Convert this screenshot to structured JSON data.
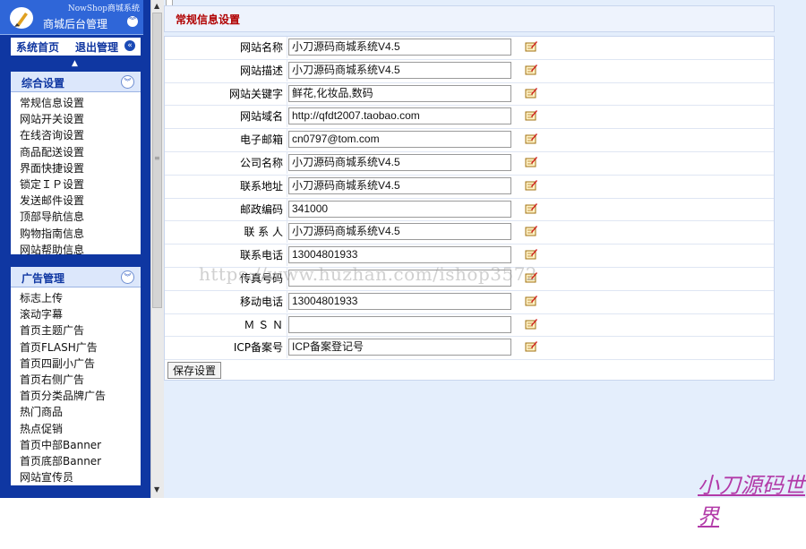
{
  "brand": {
    "system_name": "NowShop商城系统",
    "title": "商城后台管理"
  },
  "topnav": {
    "home": "系统首页",
    "logout": "退出管理"
  },
  "panels": [
    {
      "title": "综合设置",
      "items": [
        "常规信息设置",
        "网站开关设置",
        "在线咨询设置",
        "商品配送设置",
        "界面快捷设置",
        "锁定ＩＰ设置",
        "发送邮件设置",
        "顶部导航信息",
        "购物指南信息",
        "网站帮助信息"
      ]
    },
    {
      "title": "广告管理",
      "items": [
        "标志上传",
        "滚动字幕",
        "首页主题广告",
        "首页FLASH广告",
        "首页四副小广告",
        "首页右侧广告",
        "首页分类品牌广告",
        "热门商品",
        "热点促销",
        "首页中部Banner",
        "首页底部Banner",
        "网站宣传员"
      ]
    }
  ],
  "main": {
    "header": "常规信息设置",
    "save_button": "保存设置"
  },
  "form_rows": [
    {
      "label": "网站名称",
      "value": "小刀源码商城系统V4.5"
    },
    {
      "label": "网站描述",
      "value": "小刀源码商城系统V4.5"
    },
    {
      "label": "网站关键字",
      "value": "鲜花,化妆品,数码"
    },
    {
      "label": "网站域名",
      "value": "http://qfdt2007.taobao.com"
    },
    {
      "label": "电子邮箱",
      "value": "cn0797@tom.com"
    },
    {
      "label": "公司名称",
      "value": "小刀源码商城系统V4.5"
    },
    {
      "label": "联系地址",
      "value": "小刀源码商城系统V4.5"
    },
    {
      "label": "邮政编码",
      "value": "341000"
    },
    {
      "label": "联 系 人",
      "value": "小刀源码商城系统V4.5"
    },
    {
      "label": "联系电话",
      "value": "13004801933"
    },
    {
      "label": "传真号码",
      "value": ""
    },
    {
      "label": "移动电话",
      "value": "13004801933"
    },
    {
      "label": "Ｍ Ｓ Ｎ",
      "value": ""
    },
    {
      "label": "ICP备案号",
      "value": "ICP备案登记号"
    }
  ],
  "watermark": "https://www.huzhan.com/ishop3572",
  "signature": "小刀源码世界",
  "icons": {
    "edit": "edit-note-icon",
    "brand_logo": "brush-logo-icon"
  },
  "colors": {
    "sidebar": "#0f37a2",
    "main_bg": "#e4eefc",
    "header_text": "#b00000",
    "signature": "#b23aa8"
  }
}
